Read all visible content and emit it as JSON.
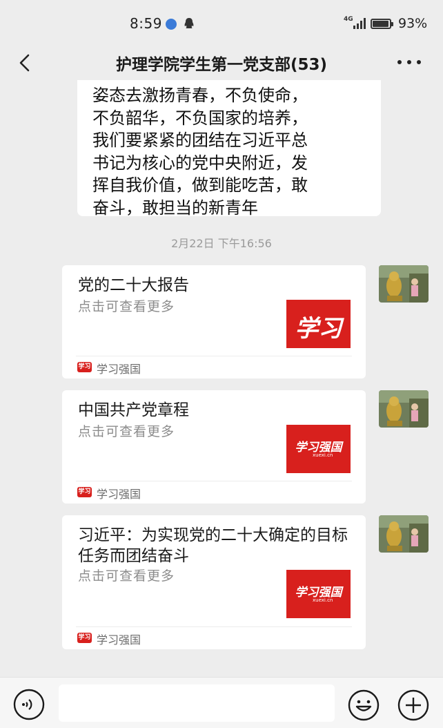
{
  "status_bar": {
    "time": "8:59",
    "network": "4G",
    "battery_percent": "93%",
    "battery_level": 0.93
  },
  "header": {
    "title": "护理学院学生第一党支部(53)",
    "back_icon": "chevron-left-icon",
    "more_icon": "more-horizontal-icon"
  },
  "messages": {
    "text_message": {
      "lines": [
        "姿态去激扬青春，不负使命，",
        "不负韶华，不负国家的培养，",
        "我们要紧紧的团结在习近平总",
        "书记为核心的党中央附近，发",
        "挥自我价值，做到能吃苦，敢",
        "奋斗，敢担当的新青年"
      ]
    },
    "timestamp": "2月22日 下午16:56",
    "cards": [
      {
        "title": "党的二十大报告",
        "desc": "点击可查看更多",
        "thumb_text": "学习",
        "source": "学习强国",
        "source_icon_text": "学习"
      },
      {
        "title": "中国共产党章程",
        "desc": "点击可查看更多",
        "thumb_text": "学习强国",
        "thumb_sub": "xuexi.cn",
        "source": "学习强国",
        "source_icon_text": "学习"
      },
      {
        "title": "习近平：为实现党的二十大确定的目标任务而团结奋斗",
        "desc": "点击可查看更多",
        "thumb_text": "学习强国",
        "thumb_sub": "xuexi.cn",
        "source": "学习强国",
        "source_icon_text": "学习"
      }
    ]
  },
  "input_bar": {
    "voice_icon": "voice-icon",
    "emoji_icon": "emoji-icon",
    "plus_icon": "plus-icon"
  },
  "colors": {
    "background": "#ededed",
    "bubble": "#ffffff",
    "brand_red": "#d8201d",
    "timestamp": "#9a9a9a"
  }
}
